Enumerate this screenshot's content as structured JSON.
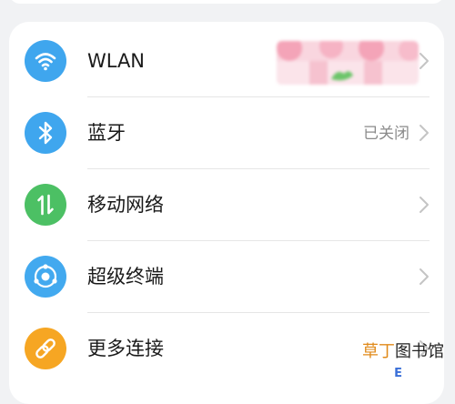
{
  "settings": {
    "items": [
      {
        "label": "WLAN",
        "status": "",
        "icon": "wifi-icon",
        "color": "#3fa6ee"
      },
      {
        "label": "蓝牙",
        "status": "已关闭",
        "icon": "bluetooth-icon",
        "color": "#3fa6ee"
      },
      {
        "label": "移动网络",
        "status": "",
        "icon": "mobile-network-icon",
        "color": "#4cc064"
      },
      {
        "label": "超级终端",
        "status": "",
        "icon": "super-device-icon",
        "color": "#42a9ef"
      },
      {
        "label": "更多连接",
        "status": "",
        "icon": "link-icon",
        "color": "#f6a623"
      }
    ]
  },
  "watermark": {
    "brand": "草丁",
    "rest": "图书馆",
    "sub": "E"
  }
}
